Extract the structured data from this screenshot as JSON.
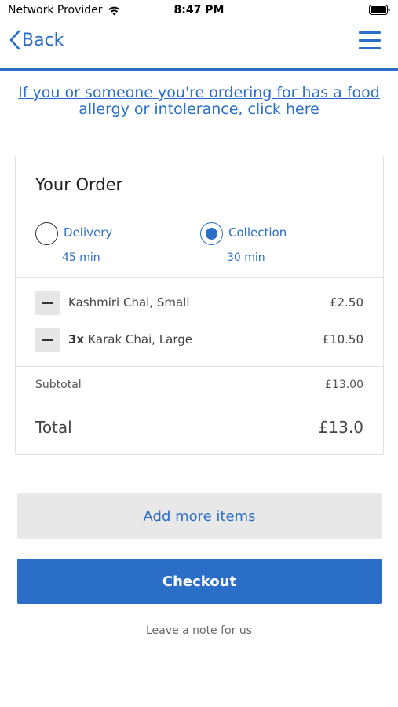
{
  "status_bar": {
    "provider": "Network Provider",
    "time": "8:47 PM",
    "wifi_icon": "wifi-icon",
    "battery_icon": "battery-icon"
  },
  "nav": {
    "back_label": "Back",
    "back_icon": "chevron-left-icon",
    "menu_icon": "hamburger-menu-icon"
  },
  "allergy_link": "If you or someone you're ordering for has a food allergy or intolerance, click here",
  "order": {
    "title": "Your Order",
    "options": [
      {
        "label": "Delivery",
        "time": "45 min",
        "selected": false
      },
      {
        "label": "Collection",
        "time": "30 min",
        "selected": true
      }
    ],
    "items": [
      {
        "qty": "",
        "name": "Kashmiri Chai, Small",
        "price": "£2.50"
      },
      {
        "qty": "3x",
        "name": "Karak Chai, Large",
        "price": "£10.50"
      }
    ],
    "subtotal_label": "Subtotal",
    "subtotal_value": "£13.00",
    "total_label": "Total",
    "total_value": "£13.0"
  },
  "actions": {
    "add_more": "Add more items",
    "checkout": "Checkout",
    "note": "Leave a note for us"
  },
  "colors": {
    "accent": "#2a6ec7",
    "button_grey": "#e8e8e8"
  }
}
